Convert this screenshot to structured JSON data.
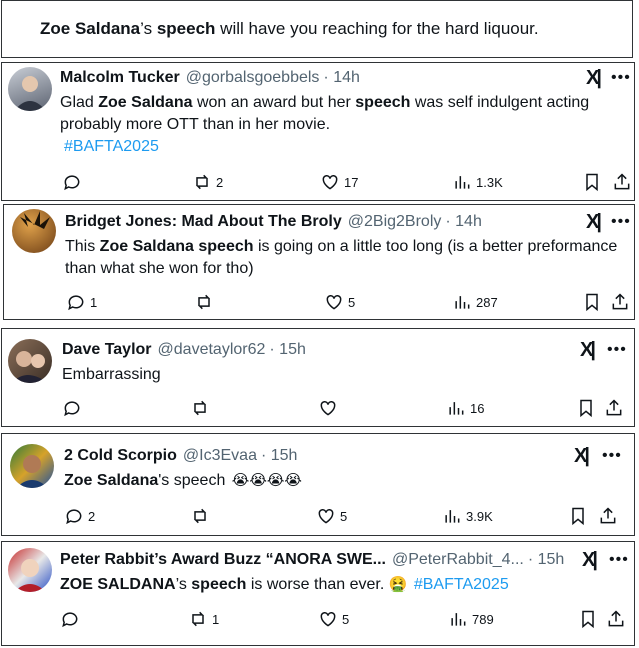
{
  "headline": {
    "pre": "Zoe Saldana",
    "mid1": "’s ",
    "bold2": "speech",
    "post": " will have you reaching for the hard liquour."
  },
  "tweets": [
    {
      "name": "Malcolm Tucker",
      "handle": "@gorbalsgoebbels",
      "time": "· 14h",
      "parts": [
        [
          "Glad ",
          false
        ],
        [
          "Zoe Saldana",
          true
        ],
        [
          " won an award but her ",
          false
        ],
        [
          "speech",
          true
        ],
        [
          " was self indulgent acting probably more OTT than in her movie.",
          false
        ]
      ],
      "hashtag": "#BAFTA2025",
      "replies": "",
      "reposts": "2",
      "likes": "17",
      "views": "1.3K"
    },
    {
      "name": "Bridget Jones: Mad About The Broly",
      "handle": "@2Big2Broly",
      "time": "· 14h",
      "parts": [
        [
          "This ",
          false
        ],
        [
          "Zoe Saldana speech",
          true
        ],
        [
          " is going on a little too long (is a better preformance than what she won for tho)",
          false
        ]
      ],
      "hashtag": "",
      "replies": "1",
      "reposts": "",
      "likes": "5",
      "views": "287"
    },
    {
      "name": "Dave Taylor",
      "handle": "@davetaylor62",
      "time": "· 15h",
      "parts": [
        [
          "Embarrassing",
          false
        ]
      ],
      "hashtag": "",
      "replies": "",
      "reposts": "",
      "likes": "",
      "views": "16"
    },
    {
      "name": "2 Cold Scorpio",
      "handle": "@Ic3Evaa",
      "time": "· 15h",
      "parts": [
        [
          "Zoe Saldana",
          true
        ],
        [
          "'s speech",
          false
        ]
      ],
      "hashtag": "",
      "replies": "2",
      "reposts": "",
      "likes": "5",
      "views": "3.9K",
      "emojis": "😭😭😭😭"
    },
    {
      "name": "Peter Rabbit’s Award Buzz “ANORA SWE...",
      "handle": "@PeterRabbit_4...",
      "time": "· 15h",
      "parts": [
        [
          "ZOE SALDANA",
          true
        ],
        [
          "’s ",
          false
        ],
        [
          "speech",
          true
        ],
        [
          " is worse than ever. ",
          false
        ]
      ],
      "hashtag": "#BAFTA2025",
      "replies": "",
      "reposts": "1",
      "likes": "5",
      "views": "789",
      "emojis": "🤮"
    }
  ],
  "icons": {
    "x_logo": "x-logo-icon",
    "more": "more-icon",
    "reply": "reply-icon",
    "repost": "repost-icon",
    "like": "like-icon",
    "views": "views-icon",
    "bookmark": "bookmark-icon",
    "share": "share-icon"
  }
}
